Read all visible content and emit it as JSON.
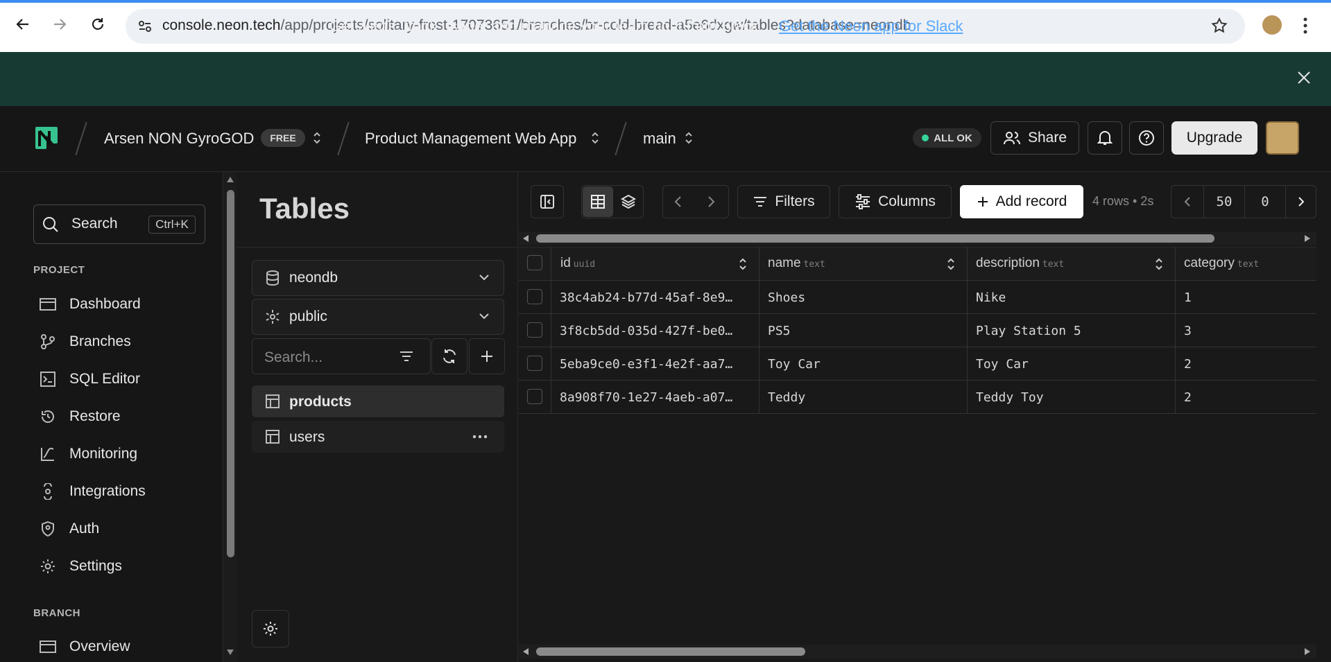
{
  "browser": {
    "url_host": "console.neon.tech",
    "url_path": "/app/projects/solitary-frost-17073651/branches/br-cold-bread-a5e6dxgw/tables?database=neondb"
  },
  "banner": {
    "text": "Get alerts, track usage, and manage your team right from Slack.",
    "link": "Get the Neon app for Slack"
  },
  "header": {
    "org": "Arsen NON GyroGOD",
    "plan": "FREE",
    "project": "Product Management Web App",
    "branch": "main",
    "status": "ALL OK",
    "share": "Share",
    "upgrade": "Upgrade"
  },
  "sidebar": {
    "search_label": "Search",
    "search_shortcut": "Ctrl+K",
    "project_section": "PROJECT",
    "items": [
      {
        "label": "Dashboard",
        "icon": "dashboard-icon"
      },
      {
        "label": "Branches",
        "icon": "branches-icon"
      },
      {
        "label": "SQL Editor",
        "icon": "sql-editor-icon"
      },
      {
        "label": "Restore",
        "icon": "restore-icon"
      },
      {
        "label": "Monitoring",
        "icon": "monitoring-icon"
      },
      {
        "label": "Integrations",
        "icon": "integrations-icon"
      },
      {
        "label": "Auth",
        "icon": "auth-icon"
      },
      {
        "label": "Settings",
        "icon": "settings-icon"
      }
    ],
    "branch_section": "BRANCH",
    "branch_items": [
      {
        "label": "Overview",
        "icon": "overview-icon"
      }
    ]
  },
  "tables_panel": {
    "title": "Tables",
    "database": "neondb",
    "schema": "public",
    "search_placeholder": "Search...",
    "tables": [
      "products",
      "users"
    ]
  },
  "toolbar": {
    "filters": "Filters",
    "columns": "Columns",
    "add_record": "Add record",
    "rows_meta": "4 rows • 2s",
    "limit": "50",
    "offset": "0"
  },
  "grid": {
    "columns": [
      {
        "name": "id",
        "type": "uuid"
      },
      {
        "name": "name",
        "type": "text"
      },
      {
        "name": "description",
        "type": "text"
      },
      {
        "name": "category",
        "type": "text"
      }
    ],
    "rows": [
      [
        "38c4ab24-b77d-45af-8e9…",
        "Shoes",
        "Nike",
        "1"
      ],
      [
        "3f8cb5dd-035d-427f-be0…",
        "PS5",
        "Play Station 5",
        "3"
      ],
      [
        "5eba9ce0-e3f1-4e2f-aa7…",
        "Toy Car",
        "Toy Car",
        "2"
      ],
      [
        "8a908f70-1e27-4aeb-a07…",
        "Teddy",
        "Teddy Toy",
        "2"
      ]
    ]
  }
}
